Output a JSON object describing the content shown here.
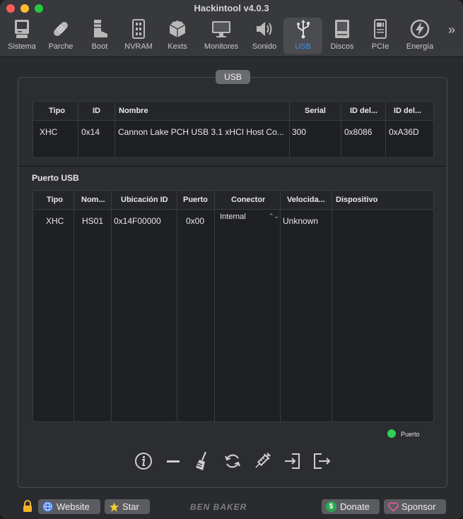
{
  "window": {
    "title": "Hackintool v4.0.3"
  },
  "toolbar": {
    "items": [
      {
        "label": "Sistema",
        "icon": "computer-icon"
      },
      {
        "label": "Parche",
        "icon": "bandage-icon"
      },
      {
        "label": "Boot",
        "icon": "boot-icon"
      },
      {
        "label": "NVRAM",
        "icon": "memory-chip-icon"
      },
      {
        "label": "Kexts",
        "icon": "puzzle-icon"
      },
      {
        "label": "Monitores",
        "icon": "monitor-icon"
      },
      {
        "label": "Sonido",
        "icon": "speaker-icon"
      },
      {
        "label": "USB",
        "icon": "usb-icon"
      },
      {
        "label": "Discos",
        "icon": "disk-icon"
      },
      {
        "label": "PCIe",
        "icon": "pcie-card-icon"
      },
      {
        "label": "Energía",
        "icon": "power-bolt-icon"
      }
    ],
    "active": "USB",
    "overflow_label": "»"
  },
  "group": {
    "tab_label": "USB"
  },
  "controllers": {
    "headers": [
      "Tipo",
      "ID",
      "Nombre",
      "Serial",
      "ID del...",
      "ID del..."
    ],
    "rows": [
      [
        "XHC",
        "0x14",
        "Cannon Lake PCH USB 3.1 xHCI Host Co...",
        "300",
        "0x8086",
        "0xA36D"
      ]
    ]
  },
  "ports": {
    "section_title": "Puerto USB",
    "headers": [
      "Tipo",
      "Nom...",
      "Ubicación ID",
      "Puerto",
      "Conector",
      "Velocida...",
      "Dispositivo"
    ],
    "rows": [
      {
        "tipo": "XHC",
        "nombre": "HS01",
        "ubicacion": "0x14F00000",
        "puerto": "0x00",
        "conector": "Internal",
        "velocidad": "Unknown",
        "dispositivo": ""
      }
    ]
  },
  "legend": {
    "label": "Puerto",
    "color": "#2fcf56"
  },
  "actions": [
    "info-icon",
    "minus-icon",
    "broom-icon",
    "refresh-icon",
    "injector-icon",
    "import-icon",
    "export-icon"
  ],
  "footer": {
    "website_label": "Website",
    "star_label": "Star",
    "brand": "BEN BAKER",
    "donate_label": "Donate",
    "sponsor_label": "Sponsor"
  },
  "colors": {
    "accent": "#3d8ff0",
    "background": "#2a2b2f",
    "toolbar": "#38393c"
  }
}
